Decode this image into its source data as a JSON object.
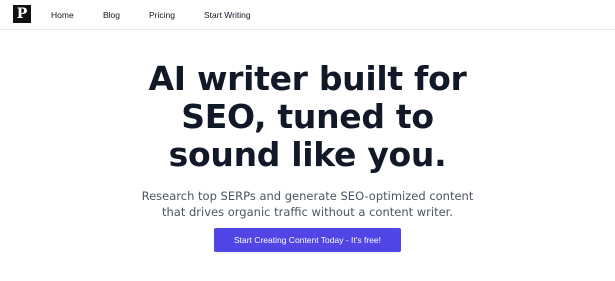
{
  "logo": {
    "letter": "P"
  },
  "nav": {
    "home": "Home",
    "blog": "Blog",
    "pricing": "Pricing",
    "start_writing": "Start Writing"
  },
  "hero": {
    "headline_line1": "AI writer built for",
    "headline_line2": "SEO, tuned to",
    "headline_line3": "sound like you.",
    "subhead_line1": "Research top SERPs and generate SEO-optimized content",
    "subhead_line2": "that drives organic traffic without a content writer.",
    "cta_label": "Start Creating Content Today - It's free!"
  },
  "colors": {
    "accent": "#4f46e5",
    "text": "#111827",
    "muted": "#4b5563",
    "logo_bg": "#111111"
  }
}
